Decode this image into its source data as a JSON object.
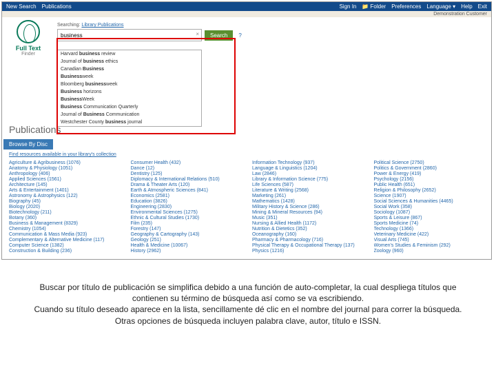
{
  "topbar": {
    "left": [
      "New Search",
      "Publications"
    ],
    "right": [
      "Sign In",
      "📁 Folder",
      "Preferences",
      "Language ▾",
      "Help",
      "Exit"
    ]
  },
  "demo": "Demonstration Customer",
  "logo": {
    "line1": "Full Text",
    "line2": "Finder"
  },
  "search": {
    "context_pre": "Searching: ",
    "context_link": "Library Publications",
    "value": "business",
    "button": "Search",
    "help": "?"
  },
  "suggestions": [
    "Harvard <b>business</b> review",
    "Journal of <b>business</b> ethics",
    "Canadian <b>Business</b>",
    "<b>Business</b>week",
    "Bloomberg <b>business</b>week",
    "<b>Business</b> horizons",
    "<b>Business</b>Week",
    "<b>Business</b> Communication Quarterly",
    "Journal of <b>Business</b> Communication",
    "Westchester County <b>business</b> journal"
  ],
  "pubs_heading": "Publications",
  "browse": "Browse By Disc",
  "hint_text": "Find resources available in your library's collection",
  "columns": [
    [
      "Agriculture & Agribusiness (1076)",
      "Anatomy & Physiology (1051)",
      "Anthropology (406)",
      "Applied Sciences (1561)",
      "Architecture (145)",
      "Arts & Entertainment (1401)",
      "Astronomy & Astrophysics (122)",
      "Biography (45)",
      "Biology (2020)",
      "Biotechnology (211)",
      "Botany (360)",
      "Business & Management (8329)",
      "Chemistry (1054)",
      "Communication & Mass Media (923)",
      "Complementary & Alternative Medicine (117)",
      "Computer Science (1382)",
      "Construction & Building (236)"
    ],
    [
      "Consumer Health (432)",
      "Dance (12)",
      "Dentistry (125)",
      "Diplomacy & International Relations (510)",
      "Drama & Theater Arts (120)",
      "Earth & Atmospheric Sciences (841)",
      "Economics (2581)",
      "Education (3826)",
      "Engineering (2830)",
      "Environmental Sciences (1275)",
      "Ethnic & Cultural Studies (1730)",
      "Film (235)",
      "Forestry (147)",
      "Geography & Cartography (143)",
      "Geology (251)",
      "Health & Medicine (10067)",
      "History (2962)"
    ],
    [
      "Information Technology (937)",
      "Language & Linguistics (1204)",
      "Law (2846)",
      "Library & Information Science (775)",
      "Life Sciences (587)",
      "Literature & Writing (2568)",
      "Marketing (261)",
      "Mathematics (1428)",
      "Military History & Science (286)",
      "Mining & Mineral Resources (94)",
      "Music (351)",
      "Nursing & Allied Health (1172)",
      "Nutrition & Dietetics (352)",
      "Oceanography (160)",
      "Pharmacy & Pharmacology (716)",
      "Physical Therapy & Occupational Therapy (137)",
      "Physics (1216)"
    ],
    [
      "Political Science (2750)",
      "Politics & Government (2860)",
      "Power & Energy (419)",
      "Psychology (2156)",
      "Public Health (651)",
      "Religion & Philosophy (2652)",
      "Science (1907)",
      "Social Sciences & Humanities (4465)",
      "Social Work (358)",
      "Sociology (1087)",
      "Sports & Leisure (867)",
      "Sports Medicine (74)",
      "Technology (1366)",
      "Veterinary Medicine (422)",
      "Visual Arts (745)",
      "Women's Studies & Feminism (292)",
      "Zoology (960)"
    ]
  ],
  "caption": {
    "p1": "Buscar por título de publicación se simplifica debido a una función de auto-completar, la cual despliega títulos que contienen su término de búsqueda así como se va escribiendo.",
    "p2": "Cuando su título deseado aparece en la lista, sencillamente dé clic en el nombre del journal para correr la búsqueda.",
    "p3": "Otras opciones de búsqueda incluyen palabra clave, autor, título e ISSN."
  }
}
